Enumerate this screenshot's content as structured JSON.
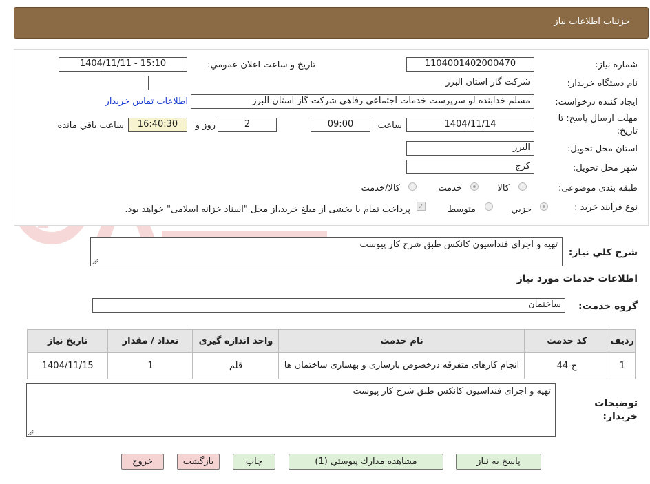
{
  "header": {
    "title": "جزئیات اطلاعات نیاز"
  },
  "form": {
    "need_number_label": "شماره نیاز:",
    "need_number": "1104001402000470",
    "announce_label": "تاریخ و ساعت اعلان عمومي:",
    "announce_value": "1404/11/11 - 15:10",
    "buyer_org_label": "نام دستگاه خریدار:",
    "buyer_org": "شرکت گاز استان البرز",
    "creator_label": "ایجاد کننده درخواست:",
    "creator": "مسلم خدابنده لو سرپرست خدمات اجتماعی رفاهی شرکت گاز استان البرز",
    "contact_link": "اطلاعات تماس خریدار",
    "deadline_label_line1": "مهلت ارسال پاسخ: تا",
    "deadline_label_line2": "تاریخ:",
    "deadline_date": "1404/11/14",
    "time_label": "ساعت",
    "deadline_time": "09:00",
    "days_value": "2",
    "days_label": "روز و",
    "remaining_time": "16:40:30",
    "remaining_label": "ساعت باقي مانده",
    "province_label": "استان محل تحویل:",
    "province": "البرز",
    "city_label": "شهر محل تحویل:",
    "city": "کرج",
    "category_label": "طبقه بندی موضوعی:",
    "category_options": [
      "کالا",
      "خدمت",
      "کالا/خدمت"
    ],
    "process_label": "نوع فرآیند خرید :",
    "process_options": [
      "جزيي",
      "متوسط"
    ],
    "payment_note": "پرداخت تمام یا بخشی از مبلغ خرید،از محل \"اسناد خزانه اسلامی\" خواهد بود."
  },
  "summary": {
    "label": "شرح کلي نیاز:",
    "value": "تهیه و اجرای فنداسیون کانکس طبق شرح کار پیوست"
  },
  "services": {
    "section_title": "اطلاعات خدمات مورد نیاز",
    "group_label": "گروه خدمت:",
    "group_value": "ساختمان",
    "columns": [
      "ردیف",
      "کد خدمت",
      "نام خدمت",
      "واحد اندازه گیری",
      "تعداد / مقدار",
      "تاریخ نیاز"
    ],
    "rows": [
      {
        "row": "1",
        "code": "ج-44",
        "name": "انجام کارهای متفرقه درخصوص بازسازی و بهسازی ساختمان ها",
        "unit": "قلم",
        "qty": "1",
        "date": "1404/11/15"
      }
    ]
  },
  "buyer_notes": {
    "label_line1": "توضیحات",
    "label_line2": "خریدار:",
    "value": "تهیه و اجرای فنداسیون کانکس طبق شرح کار پیوست"
  },
  "buttons": {
    "reply": "پاسخ به نیاز",
    "attachments": "مشاهده مدارك پیوستي (1)",
    "print": "چاپ",
    "back": "بازگشت",
    "exit": "خروج"
  },
  "colors": {
    "header_bg": "#8b6b45",
    "link": "#1a3fcf",
    "button_green": "#dff0d8",
    "button_pink": "#f6d3d3",
    "time_bg": "#f7f2cf"
  }
}
